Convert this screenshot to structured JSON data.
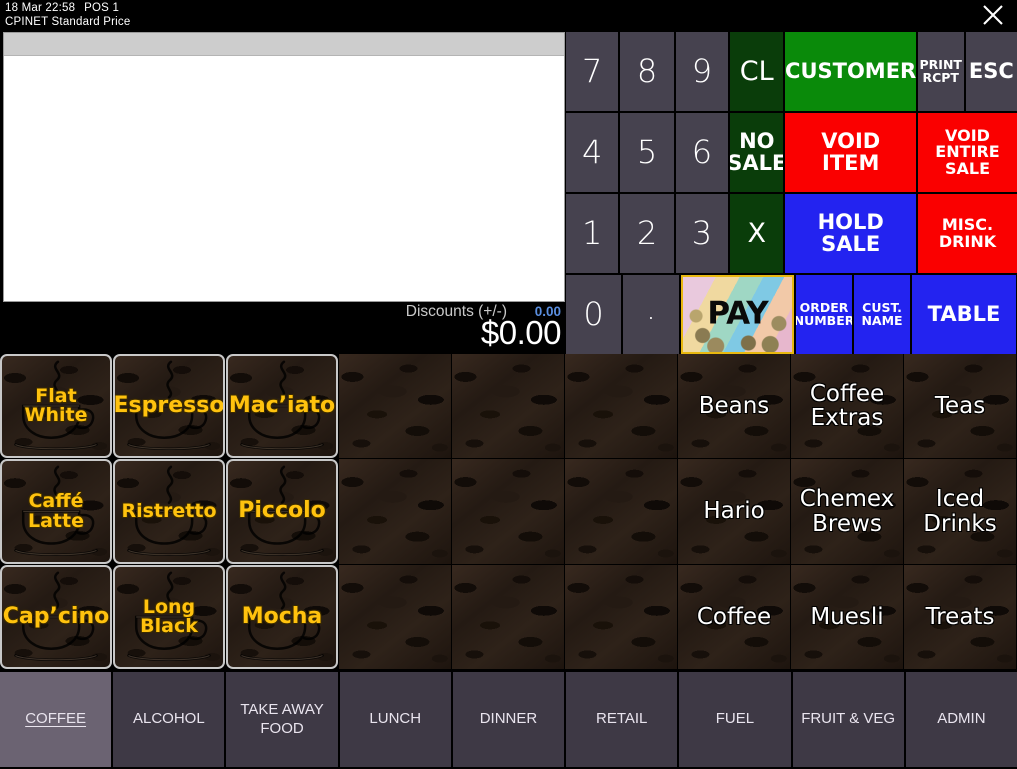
{
  "titlebar": {
    "datetime": "18 Mar 22:58",
    "pos": "POS 1",
    "store_line": "CPINET  Standard Price",
    "close_icon": "close-icon"
  },
  "receipt": {
    "header_text": "",
    "items": []
  },
  "totals": {
    "discounts_label": "Discounts (+/-)",
    "discounts_value": "0.00",
    "grand_total": "$0.00"
  },
  "keypad": {
    "rows": [
      [
        {
          "label": "7",
          "style": "num",
          "width": "w1",
          "name": "key-7"
        },
        {
          "label": "8",
          "style": "num",
          "width": "w2",
          "name": "key-8"
        },
        {
          "label": "9",
          "style": "num",
          "width": "w3",
          "name": "key-9"
        },
        {
          "label": "CL",
          "style": "dkgreen",
          "width": "w-cl",
          "name": "clear-button"
        },
        {
          "label": "CUSTOMER",
          "style": "green",
          "width": "w-cust",
          "name": "customer-button"
        },
        {
          "label": "PRINT\nRCPT",
          "style": "gray",
          "width": "w-print",
          "name": "print-receipt-button"
        },
        {
          "label": "ESC",
          "style": "gray",
          "width": "w-esc",
          "name": "escape-button"
        }
      ],
      [
        {
          "label": "4",
          "style": "num",
          "width": "w1",
          "name": "key-4"
        },
        {
          "label": "5",
          "style": "num",
          "width": "w2",
          "name": "key-5"
        },
        {
          "label": "6",
          "style": "num",
          "width": "w3",
          "name": "key-6"
        },
        {
          "label": "NO\nSALE",
          "style": "dkgreen",
          "width": "w-cl",
          "name": "no-sale-button"
        },
        {
          "label": "VOID\nITEM",
          "style": "red",
          "width": "w-void",
          "name": "void-item-button"
        },
        {
          "label": "VOID\nENTIRE\nSALE",
          "style": "red",
          "width": "w-vend",
          "name": "void-entire-sale-button"
        }
      ],
      [
        {
          "label": "1",
          "style": "num",
          "width": "w1",
          "name": "key-1"
        },
        {
          "label": "2",
          "style": "num",
          "width": "w2",
          "name": "key-2"
        },
        {
          "label": "3",
          "style": "num",
          "width": "w3",
          "name": "key-3"
        },
        {
          "label": "X",
          "style": "dkgreen",
          "width": "w-cl",
          "name": "multiply-button"
        },
        {
          "label": "HOLD\nSALE",
          "style": "blue",
          "width": "w-hold",
          "name": "hold-sale-button"
        },
        {
          "label": "MISC.\nDRINK",
          "style": "red",
          "width": "w-misc",
          "name": "misc-drink-button"
        }
      ],
      [
        {
          "label": "0",
          "style": "num",
          "width": "w1",
          "name": "key-0"
        },
        {
          "label": ".",
          "style": "dot",
          "width": "w2",
          "name": "key-decimal"
        },
        {
          "label": "PAY",
          "style": "pay",
          "width": "w-pay",
          "name": "pay-button"
        },
        {
          "label": "ORDER\nNUMBER",
          "style": "blue",
          "width": "w-ord",
          "name": "order-number-button"
        },
        {
          "label": "CUST.\nNAME",
          "style": "blue",
          "width": "w-cn",
          "name": "customer-name-button"
        },
        {
          "label": "TABLE",
          "style": "blue",
          "width": "w-tab",
          "name": "table-button"
        }
      ]
    ]
  },
  "grid": {
    "columns": 9,
    "rows": 3,
    "cells": [
      {
        "label": "Flat\nWhite",
        "kind": "coffee",
        "col": 0,
        "row": 0,
        "name": "product-flat-white"
      },
      {
        "label": "Espresso",
        "kind": "coffee",
        "col": 1,
        "row": 0,
        "name": "product-espresso"
      },
      {
        "label": "Mac’iato",
        "kind": "coffee",
        "col": 2,
        "row": 0,
        "name": "product-macchiato"
      },
      {
        "label": "",
        "kind": "empty",
        "col": 3,
        "row": 0,
        "name": "empty-cell"
      },
      {
        "label": "",
        "kind": "empty",
        "col": 4,
        "row": 0,
        "name": "empty-cell"
      },
      {
        "label": "",
        "kind": "empty",
        "col": 5,
        "row": 0,
        "name": "empty-cell"
      },
      {
        "label": "Beans",
        "kind": "cat",
        "col": 6,
        "row": 0,
        "name": "category-beans"
      },
      {
        "label": "Coffee\nExtras",
        "kind": "cat",
        "col": 7,
        "row": 0,
        "name": "category-coffee-extras"
      },
      {
        "label": "Teas",
        "kind": "cat",
        "col": 8,
        "row": 0,
        "name": "category-teas"
      },
      {
        "label": "Caffé\nLatte",
        "kind": "coffee",
        "col": 0,
        "row": 1,
        "name": "product-caffe-latte"
      },
      {
        "label": "Ristretto",
        "kind": "coffee",
        "col": 1,
        "row": 1,
        "name": "product-ristretto"
      },
      {
        "label": "Piccolo",
        "kind": "coffee",
        "col": 2,
        "row": 1,
        "name": "product-piccolo"
      },
      {
        "label": "",
        "kind": "empty",
        "col": 3,
        "row": 1,
        "name": "empty-cell"
      },
      {
        "label": "",
        "kind": "empty",
        "col": 4,
        "row": 1,
        "name": "empty-cell"
      },
      {
        "label": "",
        "kind": "empty",
        "col": 5,
        "row": 1,
        "name": "empty-cell"
      },
      {
        "label": "Hario",
        "kind": "cat",
        "col": 6,
        "row": 1,
        "name": "category-hario"
      },
      {
        "label": "Chemex\nBrews",
        "kind": "cat",
        "col": 7,
        "row": 1,
        "name": "category-chemex-brews"
      },
      {
        "label": "Iced\nDrinks",
        "kind": "cat",
        "col": 8,
        "row": 1,
        "name": "category-iced-drinks"
      },
      {
        "label": "Cap’cino",
        "kind": "coffee",
        "col": 0,
        "row": 2,
        "name": "product-cappuccino"
      },
      {
        "label": "Long\nBlack",
        "kind": "coffee",
        "col": 1,
        "row": 2,
        "name": "product-long-black"
      },
      {
        "label": "Mocha",
        "kind": "coffee",
        "col": 2,
        "row": 2,
        "name": "product-mocha"
      },
      {
        "label": "",
        "kind": "empty",
        "col": 3,
        "row": 2,
        "name": "empty-cell"
      },
      {
        "label": "",
        "kind": "empty",
        "col": 4,
        "row": 2,
        "name": "empty-cell"
      },
      {
        "label": "",
        "kind": "empty",
        "col": 5,
        "row": 2,
        "name": "empty-cell"
      },
      {
        "label": "Coffee",
        "kind": "cat",
        "col": 6,
        "row": 2,
        "name": "category-coffee"
      },
      {
        "label": "Muesli",
        "kind": "cat",
        "col": 7,
        "row": 2,
        "name": "category-muesli"
      },
      {
        "label": "Treats",
        "kind": "cat",
        "col": 8,
        "row": 2,
        "name": "category-treats"
      }
    ]
  },
  "tabs": {
    "active": "COFFEE",
    "items": [
      {
        "label": "COFFEE",
        "name": "tab-coffee"
      },
      {
        "label": "ALCOHOL",
        "name": "tab-alcohol"
      },
      {
        "label": "TAKE AWAY\nFOOD",
        "name": "tab-take-away-food"
      },
      {
        "label": "LUNCH",
        "name": "tab-lunch"
      },
      {
        "label": "DINNER",
        "name": "tab-dinner"
      },
      {
        "label": "RETAIL",
        "name": "tab-retail"
      },
      {
        "label": "FUEL",
        "name": "tab-fuel"
      },
      {
        "label": "FRUIT & VEG",
        "name": "tab-fruit-and-veg"
      },
      {
        "label": "ADMIN",
        "name": "tab-admin"
      }
    ]
  },
  "colors": {
    "accent_yellow": "#ffc20e",
    "green": "#0a8a0a",
    "dark_green": "#0a3d0a",
    "red": "#fa0000",
    "blue": "#2323f0",
    "key_gray": "#46424f",
    "tab_bg": "#3e3945",
    "tab_active_bg": "#6b6372",
    "discount_blue": "#5b8fe0"
  }
}
